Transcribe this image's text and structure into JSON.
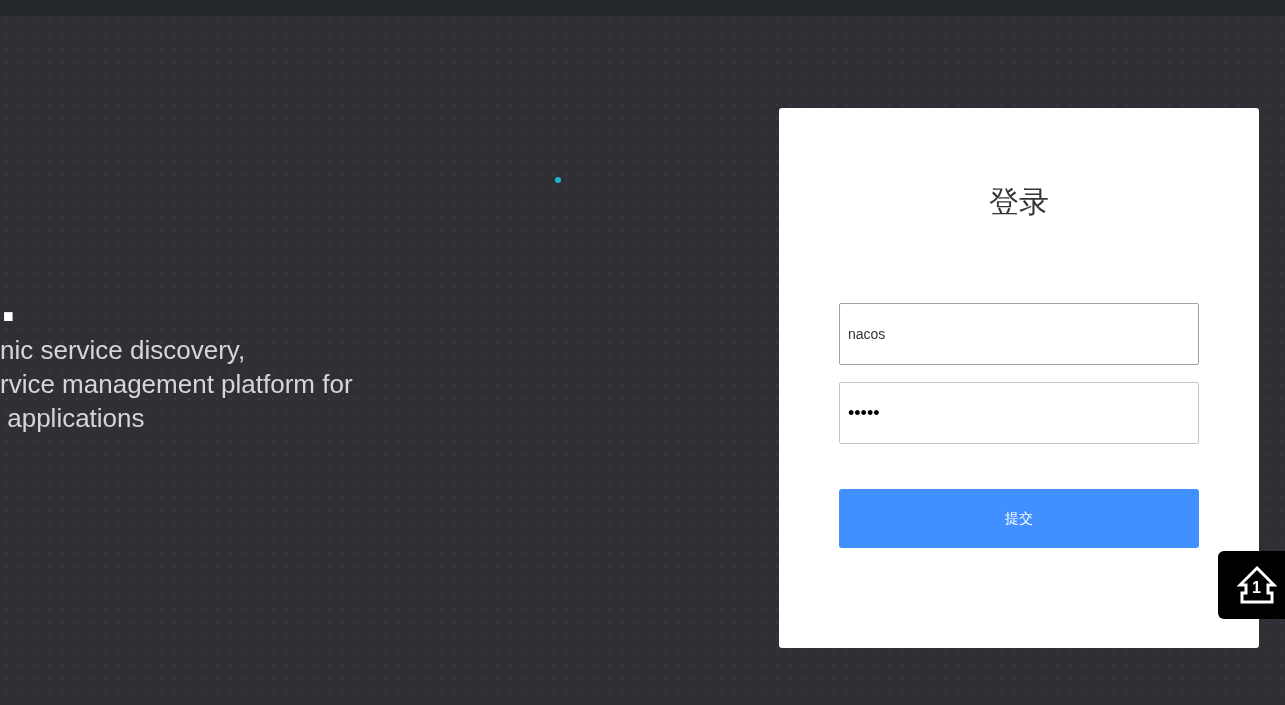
{
  "hero": {
    "title": ".",
    "description_lines": [
      "nic service discovery,",
      "rvice management platform for",
      " applications"
    ]
  },
  "login": {
    "title": "登录",
    "fields": [
      {
        "kind": "text",
        "value": "nacos",
        "focused": true
      },
      {
        "kind": "password",
        "value": "•••••",
        "focused": false
      }
    ],
    "submit": "提交"
  },
  "float_button": {
    "count": "1"
  }
}
